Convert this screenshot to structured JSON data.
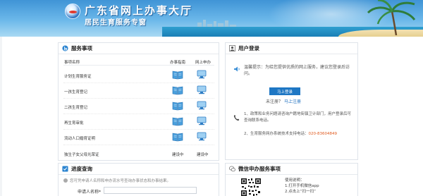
{
  "header": {
    "title": "广东省网上办事大厅",
    "subtitle": "居民生育服务专窗"
  },
  "services": {
    "title": "服务事项",
    "col_name": "事项名称",
    "col_guide": "办事指南",
    "col_apply": "网上申办",
    "rows": [
      {
        "name": "计划生育服务证",
        "guide": "",
        "apply": ""
      },
      {
        "name": "一孩生育登记",
        "guide": "",
        "apply": ""
      },
      {
        "name": "二孩生育登记",
        "guide": "",
        "apply": ""
      },
      {
        "name": "再生育审批",
        "guide": "",
        "apply": ""
      },
      {
        "name": "流动人口婚育证明",
        "guide": "",
        "apply": ""
      },
      {
        "name": "独生子女父母光荣证",
        "guide": "建设中",
        "apply": "建设中"
      }
    ]
  },
  "login": {
    "title": "用户登录",
    "tip": "温馨提示：为给您提供优质的网上服务，建议您登录后访问。",
    "login_button": "马上登录",
    "register_prefix": "未注册？",
    "register_link": "马上注册",
    "notice1": "1、政策和业务问题请咨询户籍地街镇卫计部门，用户登录后可查询联系电话。",
    "notice2_prefix": "2、生育服务网办系统技术支持电话：",
    "notice2_phone": "020-83604849"
  },
  "progress": {
    "title": "进度查询",
    "hint": "您可凭申请人名称和申办流水号查询办事状态和办事结果。",
    "applicant_label": "申请人名称*"
  },
  "wechat": {
    "title": "微信申办服务事项",
    "desc_title": "使用说明：",
    "desc_line1": "1.打开手机微信app",
    "desc_line2": "2.点击上“扫一扫”"
  },
  "colors": {
    "banner_blue": "#3f94d6",
    "link_blue": "#1e6fbf",
    "button_blue": "#1e77c4",
    "phone_orange": "#e05a1f"
  }
}
